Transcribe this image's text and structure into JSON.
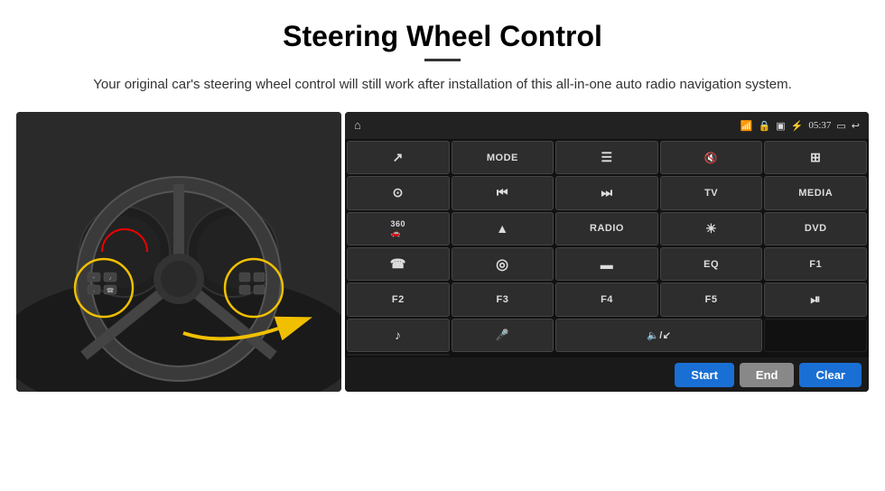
{
  "page": {
    "title": "Steering Wheel Control",
    "subtitle": "Your original car's steering wheel control will still work after installation of this all-in-one auto radio navigation system."
  },
  "topbar": {
    "time": "05:37",
    "icons": [
      "home",
      "wifi",
      "lock",
      "sim",
      "bluetooth",
      "window",
      "back"
    ]
  },
  "panel_rows": [
    [
      {
        "label": "↗",
        "type": "icon"
      },
      {
        "label": "MODE",
        "type": "text"
      },
      {
        "label": "☰",
        "type": "icon"
      },
      {
        "label": "🔇",
        "type": "icon"
      },
      {
        "label": "⊞",
        "type": "icon"
      }
    ],
    [
      {
        "label": "⊙",
        "type": "icon"
      },
      {
        "label": "⏮",
        "type": "icon"
      },
      {
        "label": "⏭",
        "type": "icon"
      },
      {
        "label": "TV",
        "type": "text"
      },
      {
        "label": "MEDIA",
        "type": "text"
      }
    ],
    [
      {
        "label": "360",
        "type": "text-small"
      },
      {
        "label": "▲",
        "type": "icon"
      },
      {
        "label": "RADIO",
        "type": "text"
      },
      {
        "label": "☀",
        "type": "icon"
      },
      {
        "label": "DVD",
        "type": "text"
      }
    ],
    [
      {
        "label": "☎",
        "type": "icon"
      },
      {
        "label": "◎",
        "type": "icon"
      },
      {
        "label": "▬",
        "type": "icon"
      },
      {
        "label": "EQ",
        "type": "text"
      },
      {
        "label": "F1",
        "type": "text"
      }
    ],
    [
      {
        "label": "F2",
        "type": "text"
      },
      {
        "label": "F3",
        "type": "text"
      },
      {
        "label": "F4",
        "type": "text"
      },
      {
        "label": "F5",
        "type": "text"
      },
      {
        "label": "⏯",
        "type": "icon"
      }
    ],
    [
      {
        "label": "♪",
        "type": "icon"
      },
      {
        "label": "🎤",
        "type": "icon"
      },
      {
        "label": "🔈/↙",
        "type": "icon"
      },
      {
        "label": "",
        "type": "empty"
      },
      {
        "label": "",
        "type": "empty"
      }
    ]
  ],
  "bottom_buttons": {
    "start": "Start",
    "end": "End",
    "clear": "Clear"
  }
}
